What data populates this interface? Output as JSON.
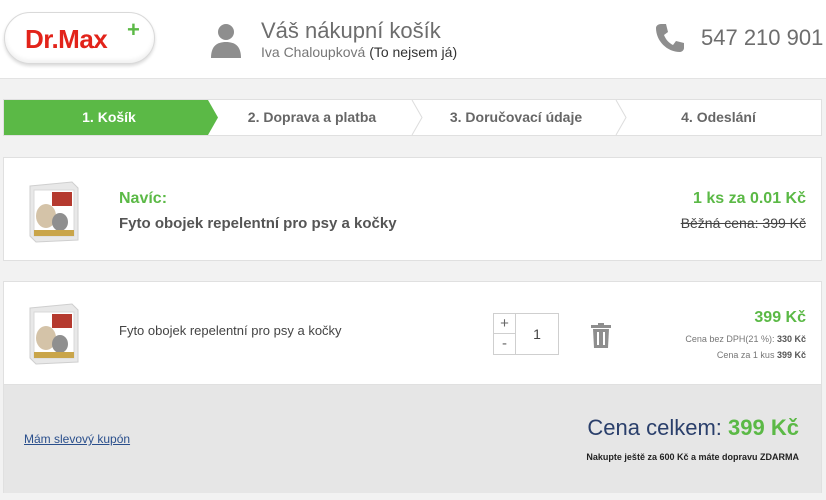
{
  "header": {
    "logo_text": "Dr.Max",
    "logo_plus": "+",
    "cart_title": "Váš nákupní košík",
    "user_name": "Iva Chaloupková",
    "not_me_link": "(To nejsem já)",
    "phone": "547 210 901",
    "icons": [
      "user-icon",
      "phone-icon"
    ]
  },
  "steps": [
    {
      "label": "1. Košík",
      "active": true
    },
    {
      "label": "2. Doprava a platba",
      "active": false
    },
    {
      "label": "3. Doručovací údaje",
      "active": false
    },
    {
      "label": "4. Odeslání",
      "active": false
    }
  ],
  "promo": {
    "label": "Navíc:",
    "product_name": "Fyto obojek repelentní pro psy a kočky",
    "price": "1 ks za 0.01 Kč",
    "regular_price": "Běžná cena: 399 Kč"
  },
  "item": {
    "product_name": "Fyto obojek repelentní pro psy a kočky",
    "qty_plus": "+",
    "qty_minus": "-",
    "quantity": "1",
    "price": "399 Kč",
    "vat_label": "Cena bez DPH(21 %):",
    "vat_value": "330 Kč",
    "unit_label": "Cena za 1 kus",
    "unit_value": "399 Kč"
  },
  "summary": {
    "coupon_link": "Mám slevový kupón",
    "total_label": "Cena celkem:",
    "total_value": "399 Kč",
    "shipping_note": "Nakupte ještě za 600 Kč a máte dopravu ZDARMA"
  },
  "colors": {
    "brand_red": "#e2231a",
    "accent_green": "#5bb946",
    "navy": "#2a3f6b"
  }
}
